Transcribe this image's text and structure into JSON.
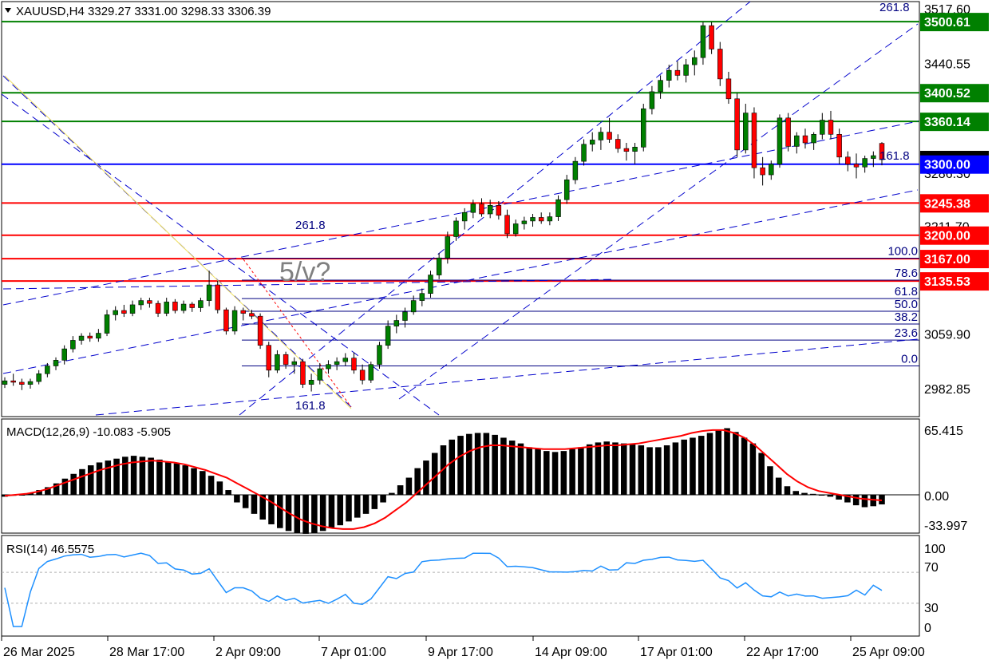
{
  "header": {
    "symbol_line": "XAUUSD,H4  3329.27 3331.00 3298.33 3306.39",
    "wave_label": "5/v?"
  },
  "colors": {
    "bull": "#008000",
    "bear": "#ff0000",
    "resistance": "#008000",
    "support_red": "#ff0000",
    "pivot": "#0000ff",
    "channel": "#0000cc",
    "fib": "#000080",
    "macd_signal": "#ff0000",
    "rsi": "#1e90ff"
  },
  "price_axis_labels": [
    "3517.60",
    "3440.55",
    "3364.65",
    "3286.30",
    "3211.70",
    "3059.90",
    "2982.85"
  ],
  "level_boxes": [
    {
      "price": 3500.61,
      "label": "3500.61",
      "color": "#008000"
    },
    {
      "price": 3400.52,
      "label": "3400.52",
      "color": "#008000"
    },
    {
      "price": 3360.14,
      "label": "3360.14",
      "color": "#008000"
    },
    {
      "price": 3306.39,
      "label": "3306.39",
      "color": "#000000"
    },
    {
      "price": 3300.0,
      "label": "3300.00",
      "color": "#0000ff"
    },
    {
      "price": 3245.38,
      "label": "3245.38",
      "color": "#ff0000"
    },
    {
      "price": 3200.0,
      "label": "3200.00",
      "color": "#ff0000"
    },
    {
      "price": 3167.0,
      "label": "3167.00",
      "color": "#ff0000"
    },
    {
      "price": 3135.53,
      "label": "3135.53",
      "color": "#ff0000"
    }
  ],
  "fib_retracement": [
    {
      "level": "100.0",
      "price": 3167.6
    },
    {
      "level": "78.6",
      "price": 3136.8
    },
    {
      "level": "61.8",
      "price": 3110.8
    },
    {
      "level": "50.0",
      "price": 3092.9
    },
    {
      "level": "38.2",
      "price": 3075.0
    },
    {
      "level": "23.6",
      "price": 3052.4
    },
    {
      "level": "0.0",
      "price": 3016.0
    }
  ],
  "fib_ext_labels": [
    "261.8",
    "261.8",
    "161.8",
    "161.8"
  ],
  "x_axis_labels": [
    "26 Mar 2025",
    "28 Mar 17:00",
    "2 Apr 09:00",
    "7 Apr 01:00",
    "9 Apr 17:00",
    "14 Apr 09:00",
    "17 Apr 01:00",
    "22 Apr 17:00",
    "25 Apr 09:00"
  ],
  "macd": {
    "title": "MACD(12,26,9) -10.083 -5.905",
    "axis_labels": [
      "65.415",
      "0.00",
      "-33.997"
    ]
  },
  "rsi": {
    "title": "RSI(14) 46.5575",
    "axis_labels": [
      "100",
      "70",
      "30",
      "0"
    ]
  },
  "chart_data": {
    "type": "candlestick",
    "title": "XAUUSD,H4",
    "ylim": [
      2975,
      3530
    ],
    "candles": [
      [
        2990,
        3000,
        2985,
        2995
      ],
      [
        2995,
        3005,
        2988,
        2993
      ],
      [
        2993,
        2998,
        2982,
        2990
      ],
      [
        2990,
        2998,
        2984,
        2994
      ],
      [
        2994,
        3010,
        2990,
        3005
      ],
      [
        3005,
        3020,
        3000,
        3016
      ],
      [
        3016,
        3028,
        3010,
        3024
      ],
      [
        3024,
        3045,
        3018,
        3040
      ],
      [
        3040,
        3058,
        3035,
        3052
      ],
      [
        3052,
        3062,
        3046,
        3058
      ],
      [
        3058,
        3063,
        3050,
        3055
      ],
      [
        3055,
        3068,
        3050,
        3062
      ],
      [
        3062,
        3095,
        3058,
        3088
      ],
      [
        3088,
        3100,
        3080,
        3094
      ],
      [
        3094,
        3102,
        3085,
        3090
      ],
      [
        3090,
        3108,
        3086,
        3102
      ],
      [
        3102,
        3112,
        3095,
        3108
      ],
      [
        3108,
        3112,
        3098,
        3104
      ],
      [
        3104,
        3108,
        3085,
        3090
      ],
      [
        3090,
        3112,
        3086,
        3106
      ],
      [
        3106,
        3110,
        3090,
        3094
      ],
      [
        3094,
        3108,
        3090,
        3103
      ],
      [
        3103,
        3106,
        3092,
        3098
      ],
      [
        3098,
        3112,
        3092,
        3108
      ],
      [
        3108,
        3150,
        3100,
        3130
      ],
      [
        3130,
        3136,
        3090,
        3095
      ],
      [
        3095,
        3098,
        3060,
        3065
      ],
      [
        3065,
        3100,
        3060,
        3094
      ],
      [
        3094,
        3098,
        3080,
        3090
      ],
      [
        3090,
        3095,
        3082,
        3086
      ],
      [
        3086,
        3090,
        3040,
        3045
      ],
      [
        3045,
        3050,
        3000,
        3010
      ],
      [
        3010,
        3038,
        3006,
        3032
      ],
      [
        3032,
        3036,
        3012,
        3018
      ],
      [
        3018,
        3028,
        3005,
        3022
      ],
      [
        3022,
        3026,
        2985,
        2990
      ],
      [
        2990,
        3005,
        2980,
        2996
      ],
      [
        2996,
        3020,
        2990,
        3012
      ],
      [
        3012,
        3024,
        3005,
        3018
      ],
      [
        3018,
        3028,
        3010,
        3022
      ],
      [
        3022,
        3034,
        3016,
        3027
      ],
      [
        3027,
        3035,
        3005,
        3010
      ],
      [
        3010,
        3018,
        2990,
        2996
      ],
      [
        2996,
        3022,
        2992,
        3018
      ],
      [
        3018,
        3050,
        3012,
        3045
      ],
      [
        3045,
        3080,
        3040,
        3072
      ],
      [
        3072,
        3088,
        3062,
        3080
      ],
      [
        3080,
        3098,
        3070,
        3092
      ],
      [
        3092,
        3115,
        3088,
        3108
      ],
      [
        3108,
        3125,
        3100,
        3118
      ],
      [
        3118,
        3150,
        3112,
        3144
      ],
      [
        3144,
        3175,
        3138,
        3168
      ],
      [
        3168,
        3205,
        3160,
        3198
      ],
      [
        3198,
        3225,
        3192,
        3220
      ],
      [
        3220,
        3238,
        3208,
        3232
      ],
      [
        3232,
        3250,
        3224,
        3244
      ],
      [
        3244,
        3252,
        3226,
        3230
      ],
      [
        3230,
        3250,
        3224,
        3242
      ],
      [
        3242,
        3248,
        3222,
        3228
      ],
      [
        3228,
        3236,
        3196,
        3202
      ],
      [
        3202,
        3222,
        3198,
        3216
      ],
      [
        3216,
        3226,
        3208,
        3220
      ],
      [
        3220,
        3230,
        3212,
        3225
      ],
      [
        3225,
        3232,
        3216,
        3220
      ],
      [
        3220,
        3232,
        3214,
        3226
      ],
      [
        3226,
        3256,
        3220,
        3250
      ],
      [
        3250,
        3285,
        3244,
        3278
      ],
      [
        3278,
        3310,
        3272,
        3304
      ],
      [
        3304,
        3335,
        3298,
        3328
      ],
      [
        3328,
        3345,
        3318,
        3334
      ],
      [
        3334,
        3352,
        3320,
        3345
      ],
      [
        3345,
        3365,
        3330,
        3335
      ],
      [
        3335,
        3342,
        3316,
        3322
      ],
      [
        3322,
        3330,
        3305,
        3318
      ],
      [
        3318,
        3330,
        3300,
        3324
      ],
      [
        3324,
        3385,
        3318,
        3378
      ],
      [
        3378,
        3410,
        3370,
        3402
      ],
      [
        3402,
        3425,
        3392,
        3418
      ],
      [
        3418,
        3440,
        3408,
        3432
      ],
      [
        3432,
        3445,
        3418,
        3425
      ],
      [
        3425,
        3448,
        3415,
        3440
      ],
      [
        3440,
        3460,
        3425,
        3450
      ],
      [
        3450,
        3500,
        3440,
        3495
      ],
      [
        3495,
        3500,
        3455,
        3462
      ],
      [
        3462,
        3472,
        3410,
        3420
      ],
      [
        3420,
        3430,
        3385,
        3392
      ],
      [
        3392,
        3400,
        3310,
        3320
      ],
      [
        3320,
        3385,
        3315,
        3372
      ],
      [
        3372,
        3380,
        3280,
        3295
      ],
      [
        3295,
        3310,
        3270,
        3285
      ],
      [
        3285,
        3305,
        3278,
        3300
      ],
      [
        3300,
        3370,
        3295,
        3365
      ],
      [
        3365,
        3372,
        3318,
        3325
      ],
      [
        3325,
        3345,
        3315,
        3340
      ],
      [
        3340,
        3350,
        3322,
        3330
      ],
      [
        3330,
        3345,
        3320,
        3342
      ],
      [
        3342,
        3372,
        3335,
        3362
      ],
      [
        3362,
        3375,
        3335,
        3342
      ],
      [
        3342,
        3350,
        3300,
        3310
      ],
      [
        3310,
        3318,
        3290,
        3300
      ],
      [
        3300,
        3315,
        3280,
        3296
      ],
      [
        3296,
        3312,
        3288,
        3308
      ],
      [
        3308,
        3318,
        3296,
        3312
      ],
      [
        3329.27,
        3331,
        3298.33,
        3306.39
      ]
    ],
    "macd_hist": [
      -2,
      -1,
      0,
      2,
      5,
      8,
      12,
      17,
      22,
      27,
      31,
      34,
      36,
      38,
      40,
      41,
      40,
      39,
      37,
      35,
      33,
      31,
      28,
      25,
      20,
      14,
      5,
      -8,
      -14,
      -20,
      -26,
      -31,
      -35,
      -38,
      -40,
      -41,
      -40,
      -38,
      -35,
      -32,
      -28,
      -24,
      -20,
      -15,
      -8,
      2,
      10,
      18,
      28,
      36,
      44,
      52,
      58,
      62,
      64,
      65,
      65,
      63,
      60,
      57,
      54,
      50,
      48,
      46,
      45,
      46,
      48,
      50,
      53,
      55,
      56,
      55,
      54,
      53,
      52,
      50,
      50,
      52,
      55,
      58,
      60,
      62,
      65,
      68,
      70,
      66,
      60,
      54,
      44,
      30,
      18,
      9,
      4,
      2,
      1,
      0,
      -2,
      -5,
      -8,
      -11,
      -13,
      -12,
      -10.083
    ],
    "macd_signal": [
      -1,
      0,
      1,
      3,
      6,
      10,
      14,
      18,
      22,
      26,
      29,
      32,
      34,
      35,
      36,
      35,
      34,
      32,
      29,
      26,
      22,
      18,
      12,
      6,
      0,
      -6,
      -13,
      -20,
      -26,
      -30,
      -33,
      -35,
      -36,
      -36,
      -34,
      -30,
      -24,
      -16,
      -8,
      2,
      12,
      22,
      32,
      40,
      46,
      50,
      52,
      52,
      51,
      50,
      49,
      48,
      48,
      48,
      49,
      50,
      51,
      52,
      52,
      53,
      54,
      56,
      58,
      60,
      62,
      65,
      67,
      68,
      68,
      65,
      60,
      52,
      42,
      32,
      22,
      14,
      8,
      4,
      2,
      0,
      -2,
      -4,
      -5,
      -5.905
    ]
  }
}
